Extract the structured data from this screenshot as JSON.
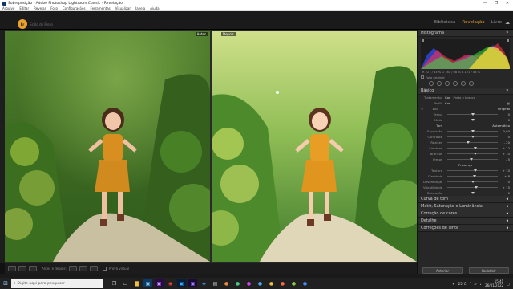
{
  "window": {
    "title": "Sobreposição - Adobe Photoshop Lightroom Classic - Revelação",
    "controls": [
      "—",
      "❐",
      "✕"
    ]
  },
  "menu": [
    "Arquivo",
    "Editar",
    "Revelar",
    "Foto",
    "Configurações",
    "Ferramentas",
    "Visualizar",
    "Janela",
    "Ajuda"
  ],
  "identity": {
    "logo": "Lr",
    "text": "Estilo de Preto"
  },
  "modules": [
    {
      "label": "Biblioteca",
      "active": false
    },
    {
      "label": "Revelação",
      "active": true
    },
    {
      "label": "Livro",
      "active": false
    }
  ],
  "viewer": {
    "before_label": "Antes",
    "after_label": "Depois"
  },
  "toolbar": {
    "before_after": "Antes e depois:",
    "soft_proof": "Prova virtual"
  },
  "right_panel": {
    "histogram": {
      "title": "Histograma",
      "info": "R 221 / 33 %   G 161 / 68 %   B 121 / 48 %",
      "original_label": "Foto original"
    },
    "basic": {
      "title": "Básico",
      "treatment_label": "Tratamento:",
      "treatment_options": [
        "Cor",
        "Preto e branco"
      ],
      "profile_label": "Perfil:",
      "profile_value": "Cor",
      "wb_label": "WB:",
      "wb_value": "Original",
      "tone_label": "Tom",
      "tone_auto": "Automático",
      "presence_label": "Presença",
      "sliders_wb": [
        {
          "label": "Temp.",
          "value": "0",
          "pos": 0.5
        },
        {
          "label": "Matiz",
          "value": "0",
          "pos": 0.5
        }
      ],
      "sliders_tone": [
        {
          "label": "Exposição",
          "value": "0,00",
          "pos": 0.5
        },
        {
          "label": "Contraste",
          "value": "0",
          "pos": 0.5
        },
        {
          "label": "Realces",
          "value": "- 20",
          "pos": 0.42
        },
        {
          "label": "Sombras",
          "value": "+ 12",
          "pos": 0.56
        },
        {
          "label": "Brancos",
          "value": "+ 10",
          "pos": 0.55
        },
        {
          "label": "Pretos",
          "value": "- 5",
          "pos": 0.48
        }
      ],
      "sliders_presence": [
        {
          "label": "Textura",
          "value": "+ 10",
          "pos": 0.55
        },
        {
          "label": "Claridade",
          "value": "+ 8",
          "pos": 0.54
        },
        {
          "label": "Desembaçar",
          "value": "0",
          "pos": 0.5
        },
        {
          "label": "Vibratilidade",
          "value": "+ 15",
          "pos": 0.57
        },
        {
          "label": "Saturação",
          "value": "0",
          "pos": 0.5
        }
      ]
    },
    "collapsed_panels": [
      "Curva de tom",
      "Matiz, Saturação e Luminância",
      "Correção de cores",
      "Detalhe",
      "Correções de lente"
    ],
    "previous_button": "Anterior",
    "reset_button": "Redefinir"
  },
  "taskbar": {
    "search_placeholder": "Digite aqui para pesquisar",
    "weather": "25°C",
    "time": "15:41",
    "date": "26/01/2022"
  },
  "colors": {
    "accent": "#e8a030",
    "panel_bg": "#272727",
    "taskbar_bg": "#202020"
  }
}
